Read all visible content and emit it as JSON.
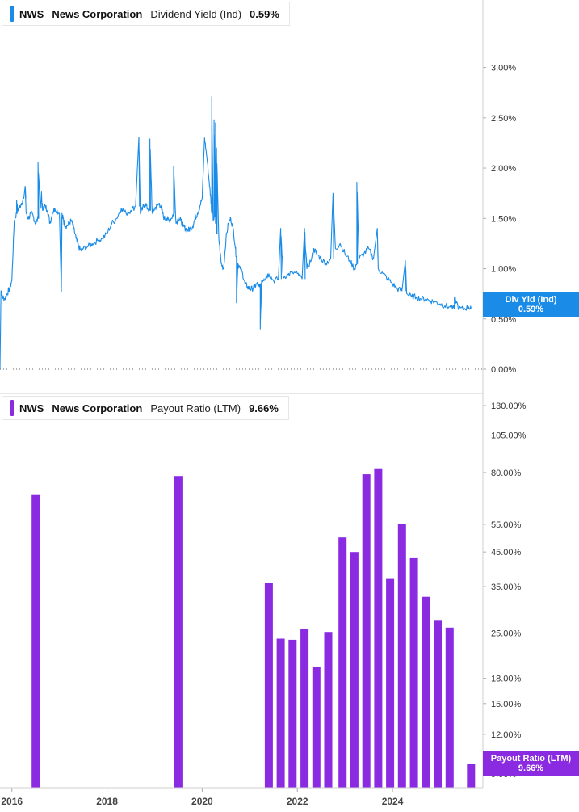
{
  "top_legend": {
    "ticker": "NWS",
    "company": "News Corporation",
    "metric": "Dividend Yield (Ind)",
    "value": "0.59%",
    "color": "#1a8ce8"
  },
  "bottom_legend": {
    "ticker": "NWS",
    "company": "News Corporation",
    "metric": "Payout Ratio (LTM)",
    "value": "9.66%",
    "color": "#8a2be2"
  },
  "flags": {
    "yield": {
      "label": "Div Yld (Ind)",
      "value": "0.59%",
      "color": "#1a8ce8"
    },
    "payout": {
      "label": "Payout Ratio (LTM)",
      "value": "9.66%",
      "color": "#8a2be2"
    }
  },
  "x_axis": {
    "ticks": [
      "2016",
      "2018",
      "2020",
      "2022",
      "2024"
    ],
    "tick_years": [
      2016,
      2018,
      2020,
      2022,
      2024
    ],
    "range": [
      2015.75,
      2025.9
    ]
  },
  "chart_data": [
    {
      "type": "line",
      "series": [
        {
          "name": "Dividend Yield (Ind)",
          "color": "#1a8ce8"
        }
      ],
      "ylim": [
        0,
        3.35
      ],
      "yticks": [
        0,
        0.5,
        1.0,
        1.5,
        2.0,
        2.5,
        3.0
      ],
      "ytick_labels": [
        "0.00%",
        "0.50%",
        "1.00%",
        "1.50%",
        "2.00%",
        "2.50%",
        "3.00%"
      ],
      "zero_line_dotted": true,
      "x": [
        2015.75,
        2015.77,
        2015.8,
        2015.85,
        2015.9,
        2015.95,
        2016.0,
        2016.05,
        2016.1,
        2016.12,
        2016.15,
        2016.2,
        2016.25,
        2016.3,
        2016.35,
        2016.4,
        2016.45,
        2016.5,
        2016.55,
        2016.6,
        2016.63,
        2016.65,
        2016.7,
        2016.75,
        2016.8,
        2016.85,
        2016.9,
        2017.0,
        2017.05,
        2017.08,
        2017.1,
        2017.15,
        2017.2,
        2017.25,
        2017.3,
        2017.35,
        2017.4,
        2017.45,
        2017.5,
        2017.6,
        2017.7,
        2017.8,
        2017.9,
        2018.0,
        2018.1,
        2018.2,
        2018.3,
        2018.4,
        2018.5,
        2018.6,
        2018.7,
        2018.75,
        2018.8,
        2018.85,
        2018.9,
        2018.95,
        2019.0,
        2019.05,
        2019.1,
        2019.15,
        2019.2,
        2019.25,
        2019.3,
        2019.35,
        2019.4,
        2019.45,
        2019.5,
        2019.55,
        2019.6,
        2019.65,
        2019.7,
        2019.75,
        2019.8,
        2019.85,
        2019.9,
        2019.95,
        2020.0,
        2020.05,
        2020.1,
        2020.15,
        2020.18,
        2020.2,
        2020.23,
        2020.25,
        2020.28,
        2020.3,
        2020.35,
        2020.4,
        2020.45,
        2020.5,
        2020.55,
        2020.6,
        2020.65,
        2020.7,
        2020.72,
        2020.75,
        2020.8,
        2020.85,
        2020.9,
        2020.95,
        2021.0,
        2021.05,
        2021.1,
        2021.15,
        2021.2,
        2021.22,
        2021.25,
        2021.3,
        2021.35,
        2021.4,
        2021.5,
        2021.6,
        2021.7,
        2021.8,
        2021.9,
        2022.0,
        2022.1,
        2022.2,
        2022.3,
        2022.35,
        2022.4,
        2022.5,
        2022.6,
        2022.7,
        2022.8,
        2022.9,
        2023.0,
        2023.1,
        2023.2,
        2023.25,
        2023.3,
        2023.4,
        2023.5,
        2023.6,
        2023.7,
        2023.8,
        2023.9,
        2024.0,
        2024.1,
        2024.2,
        2024.3,
        2024.4,
        2024.5,
        2024.6,
        2024.7,
        2024.8,
        2024.9,
        2025.0,
        2025.1,
        2025.2,
        2025.3,
        2025.4,
        2025.5,
        2025.6,
        2025.65
      ],
      "y": [
        0.0,
        0.78,
        0.72,
        0.7,
        0.75,
        0.8,
        0.88,
        1.48,
        1.55,
        1.58,
        1.6,
        1.65,
        1.7,
        1.55,
        1.5,
        1.55,
        1.52,
        1.45,
        1.5,
        1.6,
        1.65,
        1.6,
        1.62,
        1.58,
        1.45,
        1.55,
        1.6,
        1.55,
        1.52,
        1.5,
        1.45,
        1.42,
        1.45,
        1.48,
        1.4,
        1.3,
        1.22,
        1.18,
        1.2,
        1.22,
        1.25,
        1.28,
        1.3,
        1.35,
        1.45,
        1.5,
        1.6,
        1.55,
        1.58,
        1.62,
        1.55,
        1.6,
        1.65,
        1.6,
        1.58,
        1.55,
        1.6,
        1.62,
        1.65,
        1.58,
        1.5,
        1.5,
        1.48,
        1.5,
        1.55,
        1.45,
        1.5,
        1.48,
        1.42,
        1.4,
        1.38,
        1.4,
        1.42,
        1.5,
        1.55,
        1.62,
        1.7,
        2.3,
        2.1,
        1.85,
        1.7,
        1.55,
        1.5,
        1.52,
        1.45,
        1.35,
        1.3,
        1.05,
        1.0,
        1.3,
        1.45,
        1.5,
        1.4,
        1.2,
        1.1,
        1.05,
        1.0,
        0.95,
        0.85,
        0.82,
        0.8,
        0.8,
        0.82,
        0.85,
        0.82,
        0.85,
        0.88,
        0.9,
        0.92,
        0.95,
        0.88,
        0.9,
        0.92,
        0.94,
        0.96,
        0.95,
        0.9,
        1.0,
        1.1,
        1.2,
        1.15,
        1.1,
        1.05,
        1.1,
        1.2,
        1.25,
        1.15,
        1.08,
        1.0,
        1.05,
        1.1,
        1.15,
        1.2,
        1.1,
        1.0,
        0.95,
        0.9,
        0.85,
        0.8,
        0.78,
        0.75,
        0.72,
        0.72,
        0.7,
        0.7,
        0.68,
        0.67,
        0.65,
        0.63,
        0.62,
        0.6,
        0.6,
        0.6,
        0.62,
        0.6,
        0.58,
        0.59
      ],
      "spikes": [
        {
          "x": 2016.1,
          "y": 1.68
        },
        {
          "x": 2016.28,
          "y": 1.82
        },
        {
          "x": 2016.55,
          "y": 2.06
        },
        {
          "x": 2016.62,
          "y": 1.75
        },
        {
          "x": 2017.04,
          "y": 0.77
        },
        {
          "x": 2018.67,
          "y": 2.31
        },
        {
          "x": 2018.9,
          "y": 2.29
        },
        {
          "x": 2019.4,
          "y": 2.02
        },
        {
          "x": 2020.2,
          "y": 2.71
        },
        {
          "x": 2020.25,
          "y": 2.48
        },
        {
          "x": 2020.28,
          "y": 2.45
        },
        {
          "x": 2020.3,
          "y": 2.2
        },
        {
          "x": 2020.72,
          "y": 0.66
        },
        {
          "x": 2021.22,
          "y": 0.4
        },
        {
          "x": 2021.65,
          "y": 1.4
        },
        {
          "x": 2022.15,
          "y": 1.4
        },
        {
          "x": 2022.75,
          "y": 1.75
        },
        {
          "x": 2023.25,
          "y": 1.86
        },
        {
          "x": 2023.68,
          "y": 1.4
        },
        {
          "x": 2024.27,
          "y": 1.08
        },
        {
          "x": 2025.3,
          "y": 0.72
        }
      ]
    },
    {
      "type": "bar",
      "series": [
        {
          "name": "Payout Ratio (LTM)",
          "color": "#8a2be2"
        }
      ],
      "yscale": "log",
      "ylim": [
        9.0,
        130.0
      ],
      "yticks": [
        9,
        12,
        15,
        18,
        25,
        35,
        45,
        55,
        80,
        105,
        130
      ],
      "ytick_labels": [
        "9.00%",
        "12.00%",
        "15.00%",
        "18.00%",
        "25.00%",
        "35.00%",
        "45.00%",
        "55.00%",
        "80.00%",
        "105.00%",
        "130.00%"
      ],
      "x": [
        2016.5,
        2019.5,
        2021.4,
        2021.65,
        2021.9,
        2022.15,
        2022.4,
        2022.65,
        2022.95,
        2023.2,
        2023.45,
        2023.7,
        2023.95,
        2024.2,
        2024.45,
        2024.7,
        2024.95,
        2025.2,
        2025.45,
        2025.65
      ],
      "values": [
        68,
        78,
        36,
        24,
        23.8,
        25.8,
        19.5,
        25.2,
        50,
        45,
        79,
        82.5,
        37,
        55,
        43,
        32.5,
        27.5,
        26,
        0,
        9.66
      ],
      "visible": [
        true,
        true,
        true,
        true,
        true,
        true,
        true,
        true,
        true,
        true,
        true,
        true,
        true,
        true,
        true,
        true,
        true,
        true,
        false,
        true
      ]
    }
  ]
}
